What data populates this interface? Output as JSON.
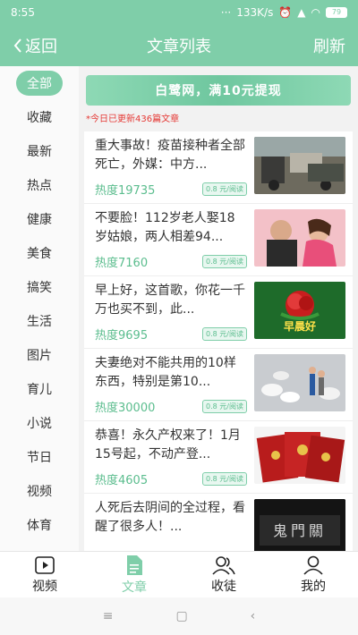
{
  "status": {
    "time": "8:55",
    "network": "133K/s",
    "battery": "79"
  },
  "header": {
    "back_label": "返回",
    "title": "文章列表",
    "refresh_label": "刷新"
  },
  "sidebar": {
    "items": [
      "全部",
      "收藏",
      "最新",
      "热点",
      "健康",
      "美食",
      "搞笑",
      "生活",
      "图片",
      "育儿",
      "小说",
      "节日",
      "视频",
      "体育"
    ],
    "active_index": 0
  },
  "banner": {
    "text": "白鹭网，满10元提现"
  },
  "notice": "*今日已更新436篇文章",
  "articles": [
    {
      "title": "重大事故！疫苗接种者全部死亡，外媒：中方...",
      "heat": "热度19735",
      "price": "0.8 元/阅读",
      "thumb": "street-scene"
    },
    {
      "title": "不要脸！112岁老人娶18岁姑娘，两人相差94...",
      "heat": "热度7160",
      "price": "0.8 元/阅读",
      "thumb": "couple"
    },
    {
      "title": "早上好，这首歌，你花一千万也买不到，此...",
      "heat": "热度9695",
      "price": "0.8 元/阅读",
      "thumb": "rose-greeting",
      "thumb_text": "早晨好"
    },
    {
      "title": "夫妻绝对不能共用的10样东西，特别是第10...",
      "heat": "热度30000",
      "price": "0.8 元/阅读",
      "thumb": "pills"
    },
    {
      "title": "恭喜！永久产权来了！1月15号起，不动产登...",
      "heat": "热度4605",
      "price": "0.8 元/阅读",
      "thumb": "property-certificates"
    },
    {
      "title": "人死后去阴间的全过程，看醒了很多人！...",
      "heat": "",
      "price": "",
      "thumb": "ghost-gate",
      "thumb_text": "鬼門關"
    }
  ],
  "tabs": [
    {
      "label": "视频",
      "icon": "video-icon"
    },
    {
      "label": "文章",
      "icon": "article-icon"
    },
    {
      "label": "收徒",
      "icon": "users-icon"
    },
    {
      "label": "我的",
      "icon": "person-icon"
    }
  ],
  "active_tab": 1,
  "colors": {
    "accent": "#7fcea9",
    "heat": "#5bbd8e",
    "notice": "#e53935"
  }
}
